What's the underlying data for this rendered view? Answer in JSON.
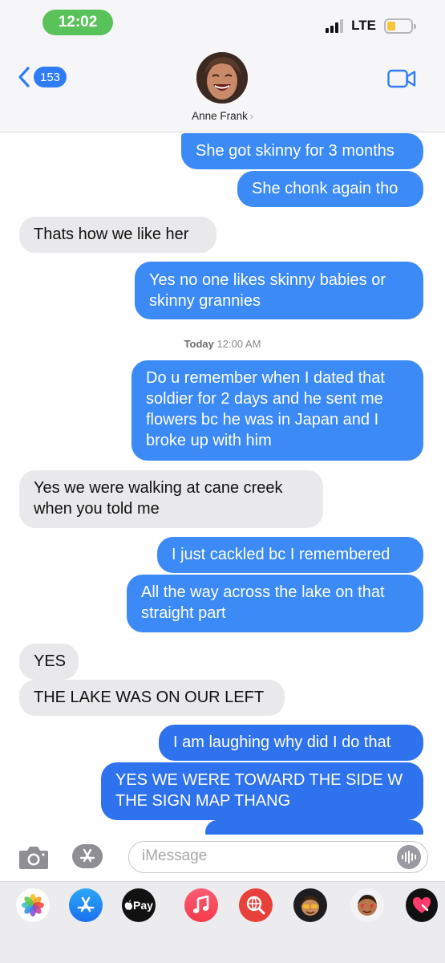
{
  "status_bar": {
    "time": "12:02",
    "network": "LTE",
    "battery_level": 0.35,
    "battery_color": "#f7c638",
    "time_pill_color": "#5ac25a"
  },
  "nav": {
    "back_icon": "chevron-left-icon",
    "unread_count": "153",
    "contact_name": "Anne Frank",
    "name_chevron": "›",
    "video_icon": "video-camera-icon",
    "accent": "#2f7cf6"
  },
  "messages": [
    {
      "dir": "out",
      "text": "She got skinny for 3 months"
    },
    {
      "dir": "out",
      "text": "She chonk again tho"
    },
    {
      "dir": "in",
      "text": "Thats how we like her"
    },
    {
      "dir": "out",
      "text": "Yes no one likes skinny babies or skinny grannies"
    },
    {
      "dir": "out",
      "text": "Do u remember when I dated that soldier for 2 days and he sent me flowers bc he was in Japan and I broke up with him"
    },
    {
      "dir": "in",
      "text": "Yes we were walking at cane creek when you told me"
    },
    {
      "dir": "out",
      "text": "I just cackled bc I remembered"
    },
    {
      "dir": "out",
      "text": "All the way across the lake on that straight part"
    },
    {
      "dir": "in",
      "text": "YES"
    },
    {
      "dir": "in",
      "text": "THE LAKE WAS ON OUR LEFT"
    },
    {
      "dir": "out",
      "text": "I am laughing why did I do that"
    },
    {
      "dir": "out",
      "text": "YES WE WERE TOWARD THE SIDE W THE SIGN MAP THANG"
    }
  ],
  "timestamp": {
    "day": "Today",
    "time": "12:00 AM"
  },
  "composer": {
    "placeholder": "iMessage",
    "camera_icon": "camera-icon",
    "apps_icon": "app-store-icon",
    "voice_icon": "waveform-icon"
  },
  "app_drawer": {
    "apps": [
      "photos-icon",
      "app-store-icon",
      "apple-pay-icon",
      "music-icon",
      "web-search-icon",
      "memoji-icon",
      "memoji-hearts-icon",
      "digital-touch-icon"
    ],
    "apple_pay_label": "Pay"
  },
  "colors": {
    "outgoing_bubble": "#3b8af5",
    "incoming_bubble": "#e9e9eb"
  }
}
